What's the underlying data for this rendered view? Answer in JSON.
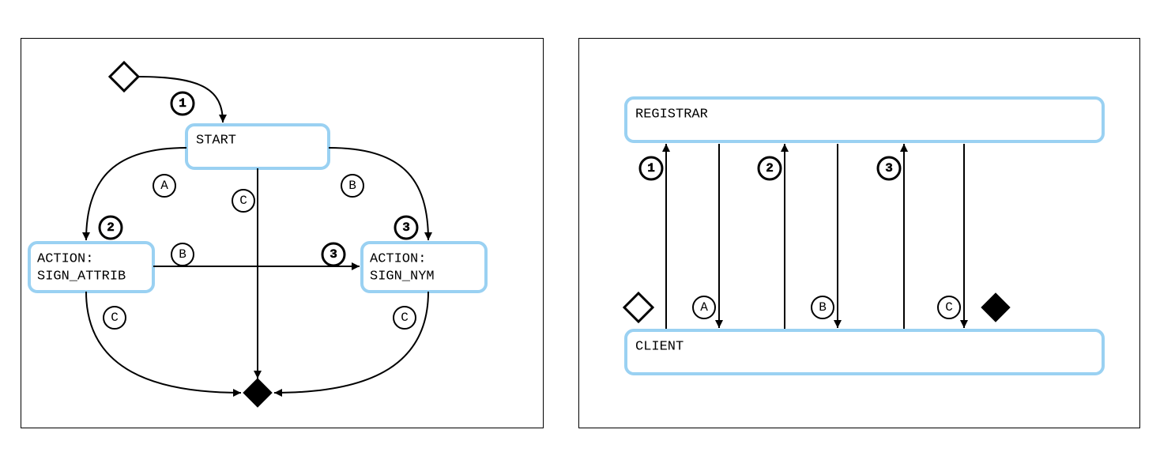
{
  "left": {
    "nodes": {
      "start": {
        "label": "START"
      },
      "sign_attrib": {
        "label_l1": "ACTION:",
        "label_l2": "SIGN_ATTRIB"
      },
      "sign_nym": {
        "label_l1": "ACTION:",
        "label_l2": "SIGN_NYM"
      }
    },
    "badges": {
      "one": "1",
      "two": "2",
      "three": "3",
      "a": "A",
      "b": "B",
      "c": "C"
    }
  },
  "right": {
    "lanes": {
      "registrar": "REGISTRAR",
      "client": "CLIENT"
    },
    "badges": {
      "one": "1",
      "two": "2",
      "three": "3",
      "a": "A",
      "b": "B",
      "c": "C"
    }
  }
}
